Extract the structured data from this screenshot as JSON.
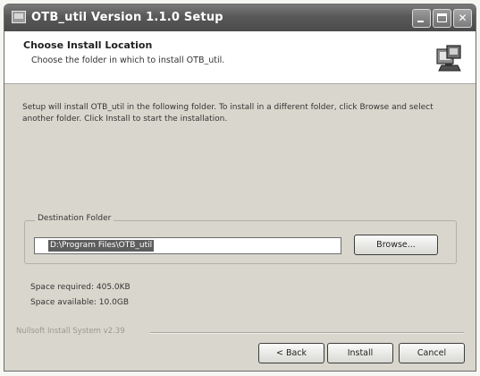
{
  "window": {
    "title": "OTB_util Version 1.1.0 Setup",
    "minimize_icon": "minimize-icon",
    "maximize_icon": "maximize-icon",
    "close_glyph": "✕"
  },
  "header": {
    "title": "Choose Install Location",
    "subtitle": "Choose the folder in which to install OTB_util.",
    "icon": "installer-icon"
  },
  "intro_text": "Setup will install OTB_util in the following folder. To install in a different folder, click Browse and select another folder. Click Install to start the installation.",
  "destination": {
    "label": "Destination Folder",
    "path": "D:\\Program Files\\OTB_util",
    "browse_label": "Browse..."
  },
  "space": {
    "required": "Space required: 405.0KB",
    "available": "Space available: 10.0GB"
  },
  "branding": "Nullsoft Install System v2.39",
  "buttons": {
    "back": "< Back",
    "install": "Install",
    "cancel": "Cancel"
  },
  "colors": {
    "titlebar": "#585858",
    "header_bg": "#ffffff",
    "body_bg": "#d9d7cd",
    "selection": "#5d5d5d"
  }
}
